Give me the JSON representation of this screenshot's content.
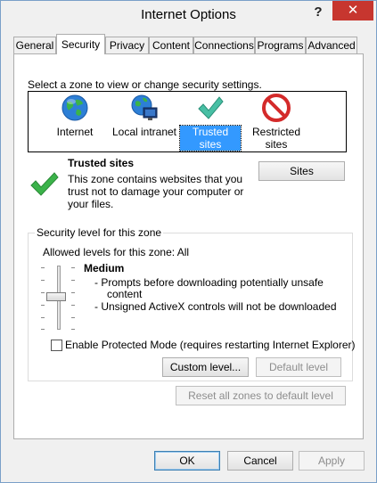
{
  "window": {
    "title": "Internet Options",
    "help_glyph": "?",
    "close_glyph": "✕",
    "close_color": "#c7362f"
  },
  "tabs": [
    {
      "label": "General"
    },
    {
      "label": "Security"
    },
    {
      "label": "Privacy"
    },
    {
      "label": "Content"
    },
    {
      "label": "Connections"
    },
    {
      "label": "Programs"
    },
    {
      "label": "Advanced"
    }
  ],
  "security": {
    "instruction": "Select a zone to view or change security settings.",
    "zones": [
      {
        "label": "Internet",
        "icon": "globe-icon"
      },
      {
        "label": "Local intranet",
        "icon": "intranet-icon"
      },
      {
        "label": "Trusted sites",
        "icon": "checkmark-icon"
      },
      {
        "label_line1": "Restricted",
        "label_line2": "sites",
        "icon": "restricted-icon"
      }
    ],
    "selected_zone": "Trusted sites",
    "zone_title": "Trusted sites",
    "zone_desc_line1": "This zone contains websites that you",
    "zone_desc_line2": "trust not to damage your computer or",
    "zone_desc_line3": "your files.",
    "sites_button": "Sites",
    "level_group_label": "Security level for this zone",
    "allowed_levels": "Allowed levels for this zone: All",
    "level_name": "Medium",
    "level_bullet1_line1": "- Prompts before downloading potentially unsafe",
    "level_bullet1_line2": "content",
    "level_bullet2": "- Unsigned ActiveX controls will not be downloaded",
    "slider_level": 0.5,
    "protected_mode_label": "Enable Protected Mode (requires restarting Internet Explorer)",
    "protected_mode_checked": false,
    "custom_level_button": "Custom level...",
    "default_level_button": "Default level",
    "reset_button": "Reset all zones to default level"
  },
  "footer": {
    "ok": "OK",
    "cancel": "Cancel",
    "apply": "Apply"
  },
  "colors": {
    "selection": "#3399ff",
    "check_green": "#3bb34a",
    "restricted_red": "#d42a2a",
    "globe_blue": "#2d7fd6"
  }
}
